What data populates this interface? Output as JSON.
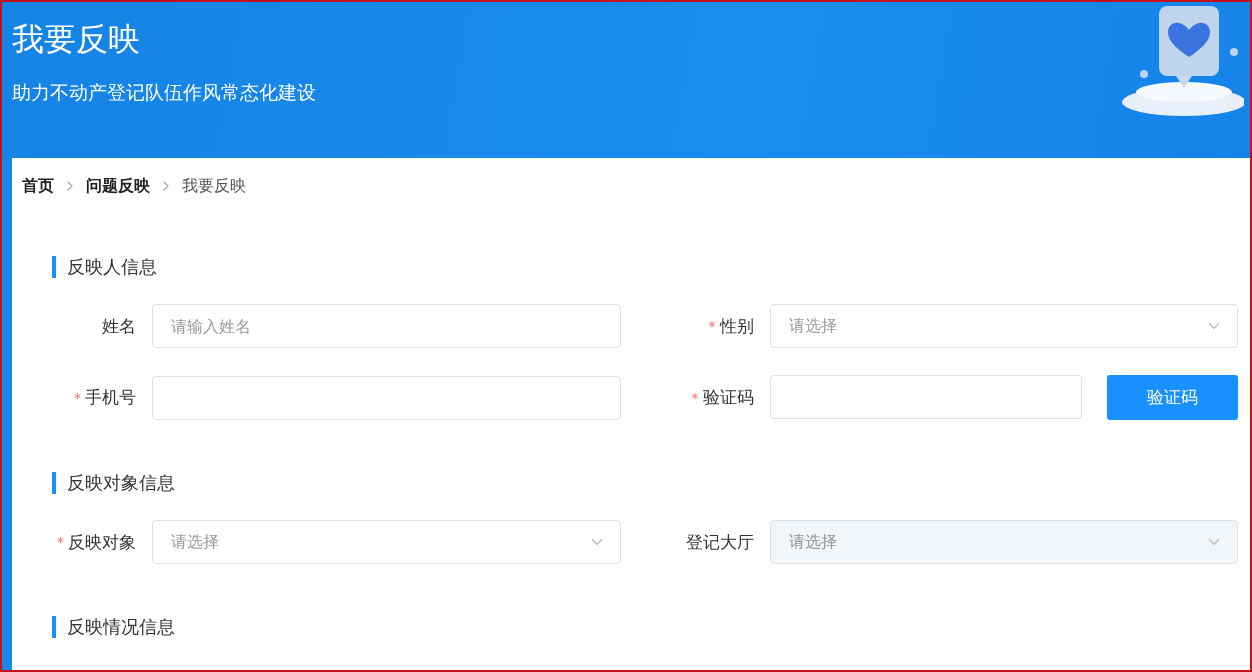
{
  "header": {
    "title": "我要反映",
    "subtitle": "助力不动产登记队伍作风常态化建设"
  },
  "breadcrumb": [
    {
      "label": "首页",
      "current": false
    },
    {
      "label": "问题反映",
      "current": false
    },
    {
      "label": "我要反映",
      "current": true
    }
  ],
  "sections": [
    {
      "title": "反映人信息",
      "fields": [
        {
          "kind": "input",
          "label": "姓名",
          "placeholder": "请输入姓名"
        },
        {
          "kind": "select",
          "label": "性别",
          "required_mark": "*",
          "placeholder": "请选择",
          "disabled": false
        },
        {
          "kind": "input",
          "label": "手机号",
          "required_mark": "*"
        },
        {
          "kind": "code",
          "label": "验证码",
          "required_mark": "*",
          "button": "验证码"
        }
      ]
    },
    {
      "title": "反映对象信息",
      "fields": [
        {
          "kind": "select",
          "label": "反映对象",
          "required_mark": "*",
          "placeholder": "请选择",
          "disabled": false
        },
        {
          "kind": "select",
          "label": "登记大厅",
          "placeholder": "请选择",
          "disabled": true
        }
      ]
    },
    {
      "title": "反映情况信息"
    }
  ]
}
